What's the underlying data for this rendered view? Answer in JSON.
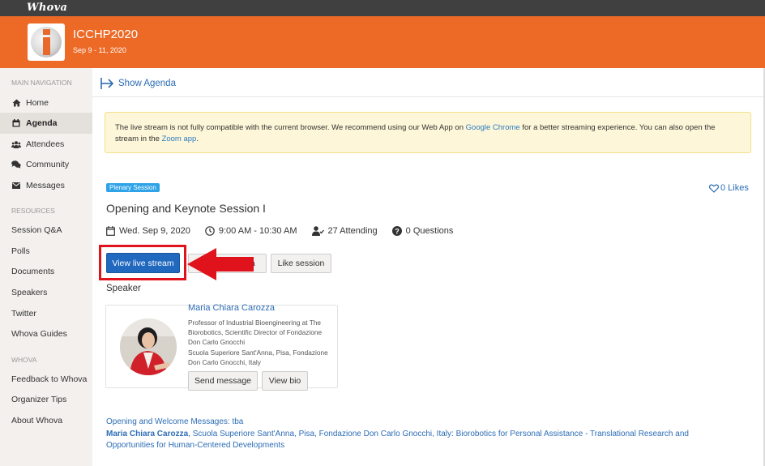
{
  "app": {
    "brand": "Whova"
  },
  "event": {
    "title": "ICCHP2020",
    "dates": "Sep 9 - 11, 2020",
    "logo": "icchp-logo"
  },
  "sidebar": {
    "sections": [
      {
        "title": "MAIN NAVIGATION",
        "items": [
          {
            "label": "Home",
            "icon": "home-icon",
            "active": false
          },
          {
            "label": "Agenda",
            "icon": "calendar-icon",
            "active": true
          },
          {
            "label": "Attendees",
            "icon": "users-icon",
            "active": false
          },
          {
            "label": "Community",
            "icon": "chat-icon",
            "active": false
          },
          {
            "label": "Messages",
            "icon": "envelope-icon",
            "active": false
          }
        ]
      },
      {
        "title": "RESOURCES",
        "items": [
          {
            "label": "Session Q&A"
          },
          {
            "label": "Polls"
          },
          {
            "label": "Documents"
          },
          {
            "label": "Speakers"
          },
          {
            "label": "Twitter"
          },
          {
            "label": "Whova Guides"
          }
        ]
      },
      {
        "title": "WHOVA",
        "items": [
          {
            "label": "Feedback to Whova"
          },
          {
            "label": "Organizer Tips"
          },
          {
            "label": "About Whova"
          }
        ]
      }
    ]
  },
  "main": {
    "show_agenda": "Show Agenda",
    "alert": {
      "text1": "The live stream is not fully compatible with the current browser. We recommend using our Web App on ",
      "link1": "Google Chrome",
      "text2": " for a better streaming experience. You can also open the stream in the ",
      "link2": "Zoom app",
      "text3": "."
    },
    "session": {
      "tag": "Plenary Session",
      "likes": "0 Likes",
      "title": "Opening and Keynote Session I",
      "date": "Wed. Sep 9, 2020",
      "time": "9:00 AM - 10:30 AM",
      "attending": "27 Attending",
      "questions": "0 Questions"
    },
    "buttons": {
      "view_live_stream": "View live stream",
      "add_to_agenda": "Add to agenda",
      "like_session": "Like session"
    },
    "speaker_label": "Speaker",
    "speaker": {
      "name": "Maria Chiara Carozza",
      "title": "Professor of Industrial Bioengineering at The Biorobotics, Scientific Director of Fondazione Don Carlo Gnocchi",
      "affiliation": "Scuola Superiore Sant'Anna, Pisa, Fondazione Don Carlo Gnocchi, Italy",
      "send_message": "Send message",
      "view_bio": "View bio"
    },
    "description": {
      "line1": "Opening and Welcome Messages: tba",
      "speaker_bold": "Maria Chiara Carozza",
      "rest": ", Scuola Superiore Sant'Anna, Pisa, Fondazione Don Carlo Gnocchi, Italy: Biorobotics for Personal Assistance - Translational Research and Opportunities for Human-Centered Developments"
    },
    "annotation": {
      "highlight_color": "#e0131c",
      "arrow_color": "#e0131c"
    }
  }
}
